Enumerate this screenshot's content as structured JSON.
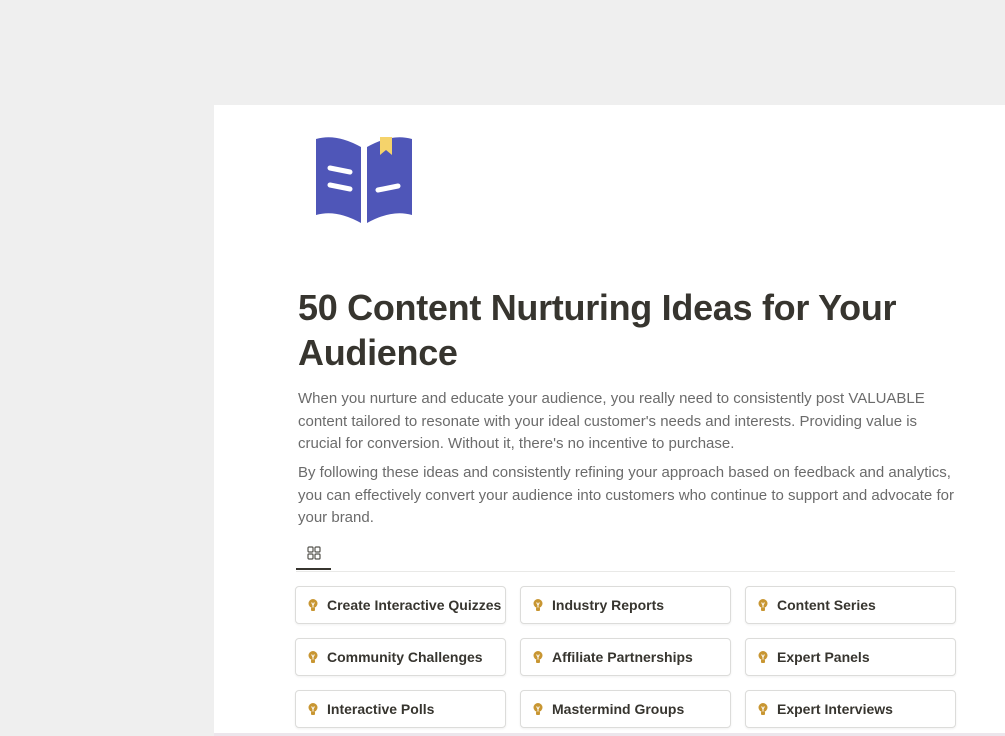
{
  "page": {
    "title": "50 Content Nurturing Ideas for Your Audience",
    "description_1": "When you nurture and educate your audience, you really need to consistently post VALUABLE content tailored to resonate with your ideal customer's needs and interests. Providing value is crucial for conversion. Without it, there's no incentive to purchase.",
    "description_2": "By following these ideas and consistently refining your approach based on feedback and analytics, you can effectively convert your audience into customers who continue to support and advocate for your brand.",
    "icon": "open-book-icon"
  },
  "view": {
    "active_tab_icon": "gallery-grid-icon"
  },
  "gallery": {
    "item_icon": "lightbulb-icon",
    "items": [
      {
        "label": "Create Interactive Quizzes"
      },
      {
        "label": "Industry Reports"
      },
      {
        "label": "Content Series"
      },
      {
        "label": "Community Challenges"
      },
      {
        "label": "Affiliate Partnerships"
      },
      {
        "label": "Expert Panels"
      },
      {
        "label": "Interactive Polls"
      },
      {
        "label": "Mastermind Groups"
      },
      {
        "label": "Expert Interviews"
      }
    ]
  },
  "colors": {
    "background": "#efefef",
    "page": "#ffffff",
    "text": "#37352f",
    "muted_text": "#6b6b6b",
    "book_blue": "#4f56b8",
    "bookmark_yellow": "#f5d36b",
    "bulb_gold": "#c89632"
  }
}
